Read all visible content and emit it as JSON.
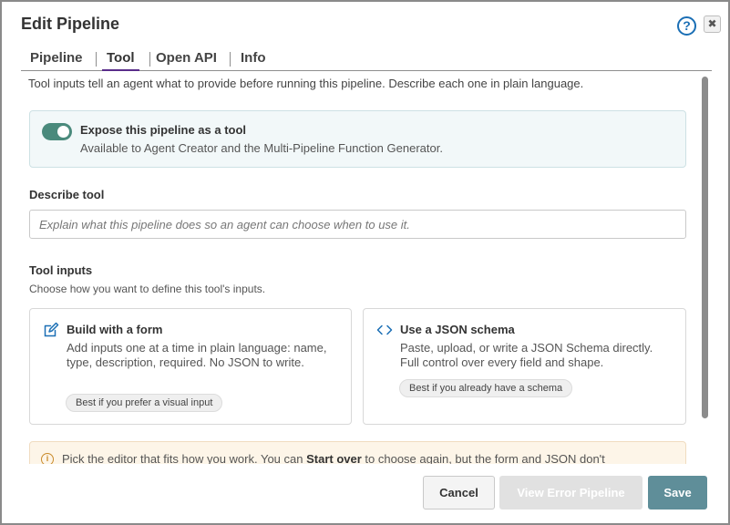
{
  "dialog": {
    "title": "Edit Pipeline",
    "help_icon": "question-circle-icon",
    "close_icon": "close-icon",
    "close_glyph": "✖"
  },
  "tabs": [
    {
      "label": "Pipeline",
      "active": false
    },
    {
      "label": "Tool",
      "active": true
    },
    {
      "label": "Open API",
      "active": false
    },
    {
      "label": "Info",
      "active": false
    }
  ],
  "intro": "Tool inputs tell an agent what to provide before running this pipeline. Describe each one in plain language.",
  "expose": {
    "enabled": true,
    "title": "Expose this pipeline as a tool",
    "subtitle": "Available to Agent Creator and the Multi-Pipeline Function Generator."
  },
  "describe": {
    "label": "Describe tool",
    "value": "",
    "placeholder": "Explain what this pipeline does so an agent can choose when to use it."
  },
  "tool_inputs": {
    "label": "Tool inputs",
    "subtitle": "Choose how you want to define this tool's inputs.",
    "cards": [
      {
        "icon": "edit-icon",
        "title": "Build with a form",
        "description": "Add inputs one at a time in plain language: name, type, description, required. No JSON to write.",
        "pill": "Best if you prefer a visual input"
      },
      {
        "icon": "code-icon",
        "title": "Use a JSON schema",
        "description": "Paste, upload, or write a JSON Schema directly. Full control over every field and shape.",
        "pill": "Best if you already have a schema"
      }
    ]
  },
  "hint": {
    "icon": "info-icon",
    "before": "Pick the editor that fits how you work. You can ",
    "emphasis": "Start over",
    "after": " to choose again, but the form and JSON don't"
  },
  "footer": {
    "cancel_label": "Cancel",
    "error_label": "View Error Pipeline",
    "save_label": "Save"
  },
  "colors": {
    "accent": "#5a2d8a",
    "toggle_on": "#4a8a7c",
    "save_button": "#5f8e99",
    "help_blue": "#1b6fb5"
  }
}
